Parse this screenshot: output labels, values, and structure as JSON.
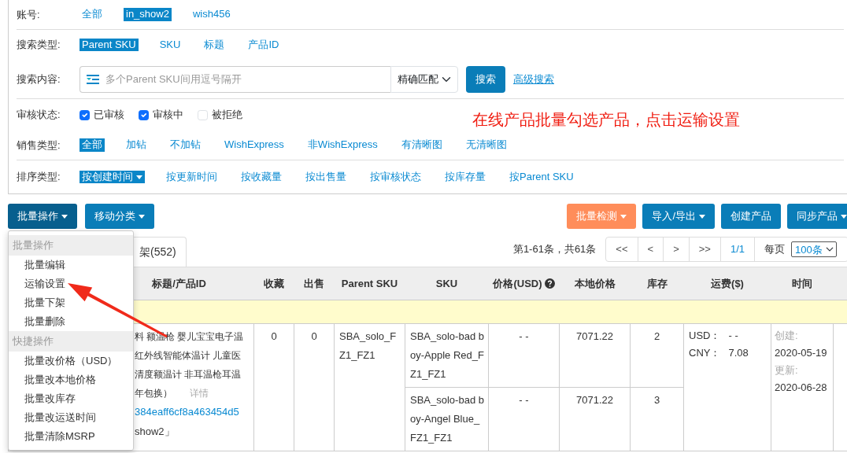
{
  "filters": {
    "account": {
      "label": "账号:",
      "options": [
        {
          "label": "全部",
          "selected": false
        },
        {
          "label": "in_show2",
          "selected": true
        },
        {
          "label": "wish456",
          "selected": false
        }
      ]
    },
    "search_type": {
      "label": "搜索类型:",
      "options": [
        {
          "label": "Parent SKU",
          "selected": true
        },
        {
          "label": "SKU",
          "selected": false
        },
        {
          "label": "标题",
          "selected": false
        },
        {
          "label": "产品ID",
          "selected": false
        }
      ]
    },
    "search_content": {
      "label": "搜索内容:",
      "placeholder": "多个Parent SKU间用逗号隔开",
      "match": "精确匹配",
      "button": "搜索",
      "advanced": "高级搜索"
    },
    "review_status": {
      "label": "审核状态:",
      "options": [
        {
          "label": "已审核",
          "checked": true
        },
        {
          "label": "审核中",
          "checked": true
        },
        {
          "label": "被拒绝",
          "checked": false
        }
      ]
    },
    "sale_type": {
      "label": "销售类型:",
      "options": [
        {
          "label": "全部",
          "selected": true
        },
        {
          "label": "加钻",
          "selected": false
        },
        {
          "label": "不加钻",
          "selected": false
        },
        {
          "label": "WishExpress",
          "selected": false
        },
        {
          "label": "非WishExpress",
          "selected": false
        },
        {
          "label": "有清晰图",
          "selected": false
        },
        {
          "label": "无清晰图",
          "selected": false
        }
      ]
    },
    "sort_type": {
      "label": "排序类型:",
      "options": [
        {
          "label": "按创建时间",
          "selected": true
        },
        {
          "label": "按更新时间",
          "selected": false
        },
        {
          "label": "按收藏量",
          "selected": false
        },
        {
          "label": "按出售量",
          "selected": false
        },
        {
          "label": "按审核状态",
          "selected": false
        },
        {
          "label": "按库存量",
          "selected": false
        },
        {
          "label": "按Parent SKU",
          "selected": false
        }
      ]
    }
  },
  "annotation": "在线产品批量勾选产品，点击运输设置",
  "toolbar_left": [
    {
      "label": "批量操作",
      "kind": "primary",
      "caret": true,
      "expanded": true
    },
    {
      "label": "移动分类",
      "kind": "primary",
      "caret": true,
      "expanded": false
    }
  ],
  "toolbar_right": [
    {
      "label": "批量检测",
      "kind": "warning",
      "caret": true,
      "expanded": false
    },
    {
      "label": "导入/导出",
      "kind": "primary",
      "caret": true,
      "expanded": false
    },
    {
      "label": "创建产品",
      "kind": "primary",
      "caret": false,
      "expanded": false
    },
    {
      "label": "同步产品",
      "kind": "primary",
      "caret": true,
      "expanded": false
    }
  ],
  "menu": [
    {
      "header": "批量操作",
      "items": [
        "批量编辑",
        "运输设置",
        "批量下架",
        "批量删除"
      ]
    },
    {
      "header": "快捷操作",
      "items": [
        "批量改价格（USD）",
        "批量改本地价格",
        "批量改库存",
        "批量改运送时间",
        "批量清除MSRP"
      ]
    }
  ],
  "tabs": [
    {
      "label": "架(552)",
      "selected": true
    }
  ],
  "pagination": {
    "summary": "第1-61条，共61条",
    "buttons": [
      "<<",
      "<",
      ">",
      ">>"
    ],
    "page": "1/1",
    "per_page_label": "每页",
    "per_page": "100条"
  },
  "table": {
    "columns": [
      {
        "label": "标题/产品ID",
        "help": false
      },
      {
        "label": "收藏",
        "help": false
      },
      {
        "label": "出售",
        "help": false
      },
      {
        "label": "Parent SKU",
        "help": false
      },
      {
        "label": "SKU",
        "help": false
      },
      {
        "label": "价格(USD)",
        "help": true
      },
      {
        "label": "本地价格",
        "help": false
      },
      {
        "label": "库存",
        "help": false
      },
      {
        "label": "运费($)",
        "help": false
      },
      {
        "label": "时间",
        "help": false
      }
    ],
    "rows": [
      {
        "title_lines": [
          "料 额温枪 婴儿宝宝电子温",
          "红外线智能体温计 儿童医",
          "清度额温计 非耳温枪耳温",
          "年包换）"
        ],
        "details": "详情",
        "product_id": "384eaff6cf8a463454d5",
        "account": "show2」",
        "favorites": "0",
        "sold": "0",
        "parent_sku": "SBA_solo_FZ1_FZ1",
        "variants": [
          {
            "sku": "SBA_solo-bad boy-Apple Red_FZ1_FZ1",
            "price": "- -",
            "local_price": "7071.22",
            "stock": "2"
          },
          {
            "sku": "SBA_solo-bad boy-Angel Blue_FZ1_FZ1",
            "price": "- -",
            "local_price": "7071.22",
            "stock": "3"
          }
        ],
        "shipping": [
          {
            "label": "USD：",
            "value": "- -"
          },
          {
            "label": "CNY：",
            "value": "7.08"
          }
        ],
        "time": [
          {
            "label": "创建:",
            "value": "2020-05-19"
          },
          {
            "label": "更新:",
            "value": "2020-06-28"
          }
        ]
      }
    ]
  }
}
